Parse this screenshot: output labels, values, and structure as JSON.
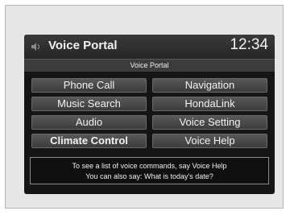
{
  "header": {
    "title": "Voice Portal",
    "clock": "12:34",
    "icon": "voice-icon"
  },
  "subtitle": "Voice Portal",
  "buttons": [
    {
      "label": "Phone Call"
    },
    {
      "label": "Navigation"
    },
    {
      "label": "Music Search"
    },
    {
      "label": "HondaLink"
    },
    {
      "label": "Audio"
    },
    {
      "label": "Voice Setting"
    },
    {
      "label": "Climate Control"
    },
    {
      "label": "Voice Help"
    }
  ],
  "info": {
    "line1": "To see a list of voice commands, say Voice Help",
    "line2": "You can also say: What is today's date?"
  },
  "colors": {
    "screen_background": "#151515",
    "button_background": "#4a4a4a",
    "text": "#f2f2f2",
    "page_frame": "#e6e6e6"
  }
}
